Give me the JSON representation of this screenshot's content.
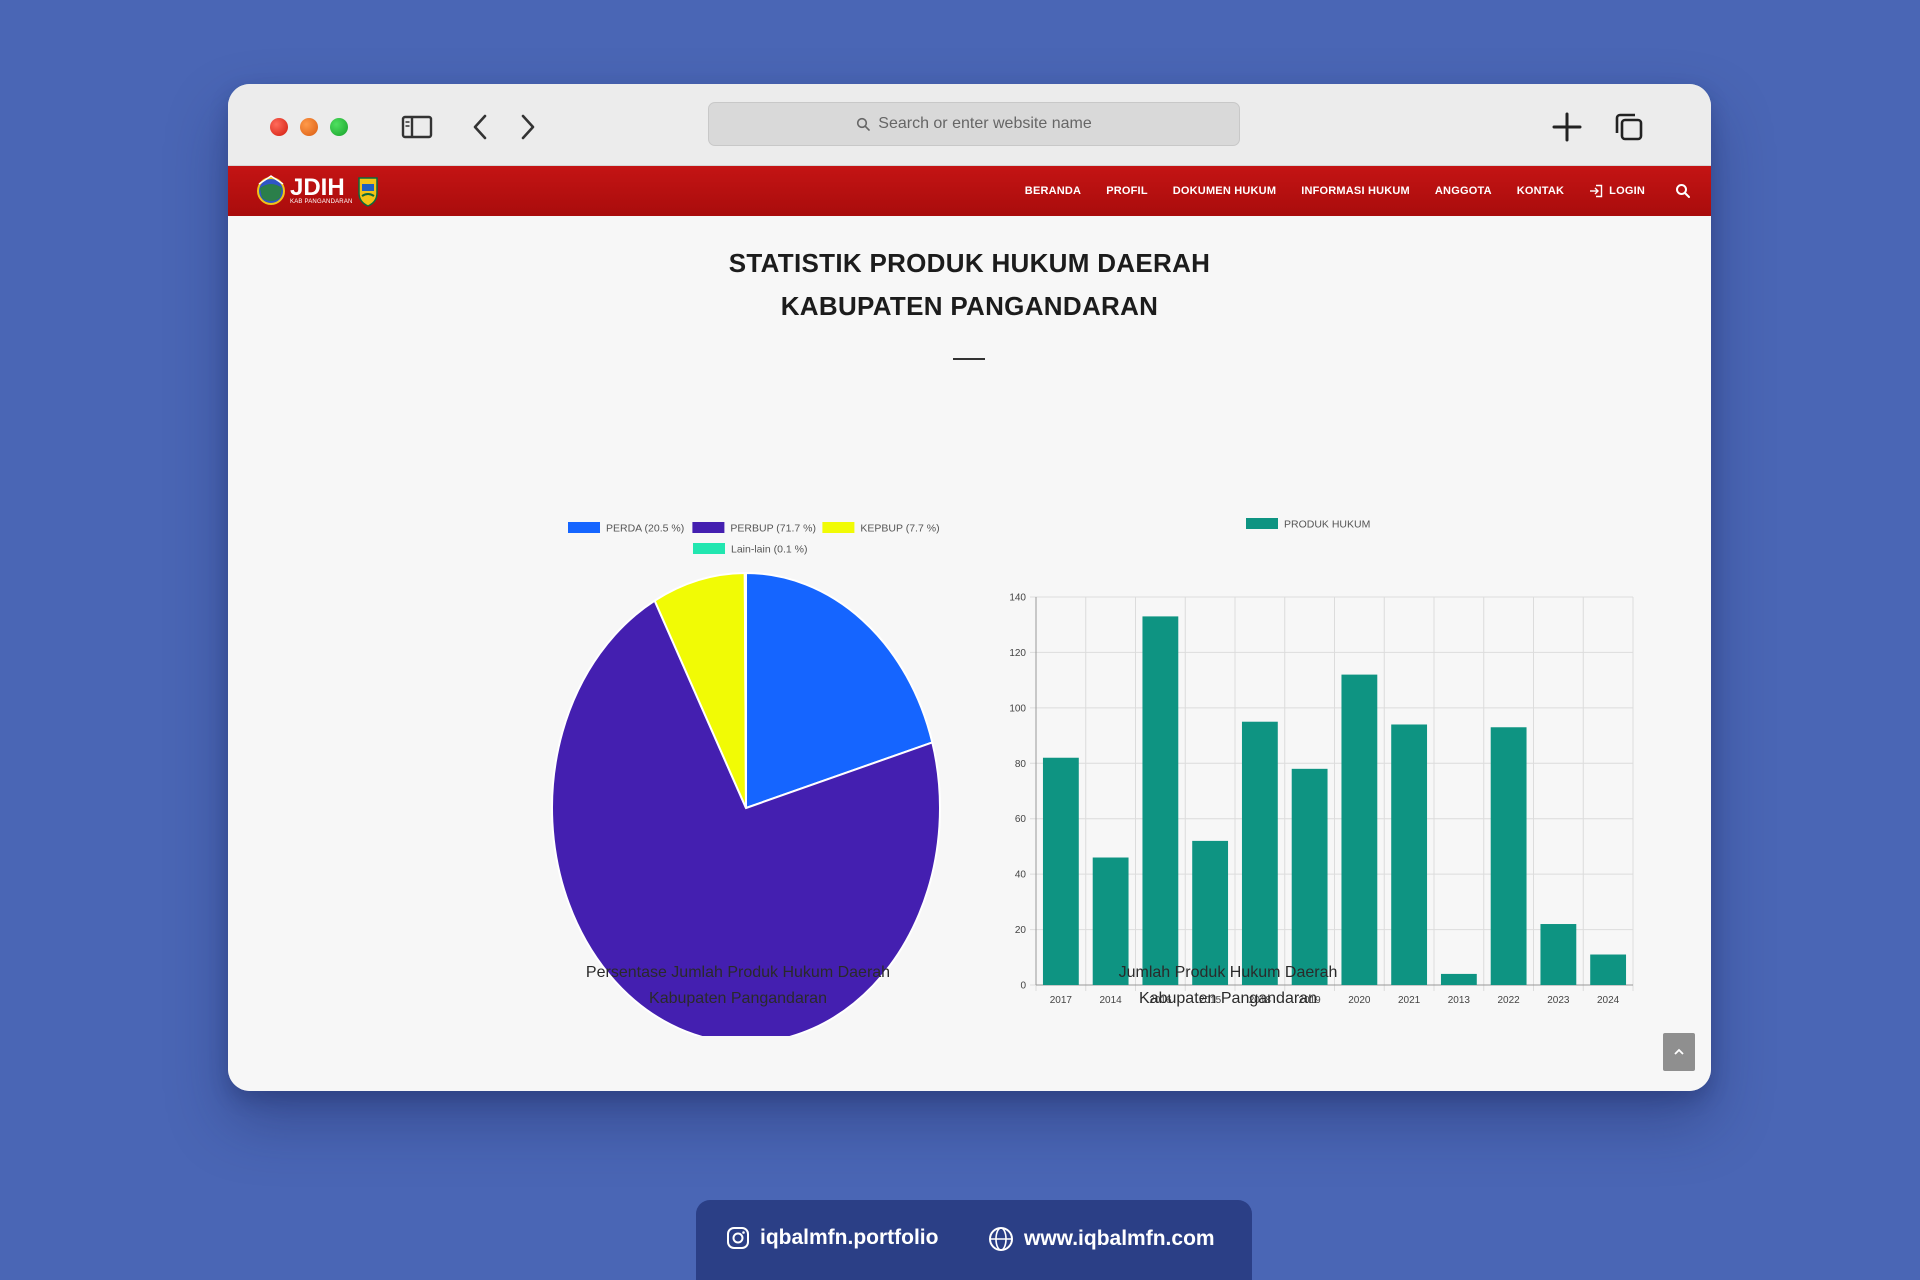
{
  "browser": {
    "address_placeholder": "Search or enter website name"
  },
  "site": {
    "logo_title": "JDIH",
    "logo_subtitle": "KAB PANGANDARAN",
    "menu": [
      {
        "label": "BERANDA"
      },
      {
        "label": "PROFIL"
      },
      {
        "label": "DOKUMEN HUKUM"
      },
      {
        "label": "INFORMASI HUKUM"
      },
      {
        "label": "ANGGOTA"
      },
      {
        "label": "KONTAK"
      },
      {
        "label": "LOGIN"
      }
    ]
  },
  "page": {
    "title_line1": "STATISTIK PRODUK HUKUM DAERAH",
    "title_line2": "KABUPATEN PANGANDARAN",
    "pie_caption_line1": "Persentase Jumlah Produk Hukum Daerah",
    "pie_caption_line2": "Kabupaten Pangandaran",
    "bar_caption_line1": "Jumlah Produk Hukum Daerah",
    "bar_caption_line2": "Kabupaten Pangandaran"
  },
  "chart_data": [
    {
      "type": "pie",
      "labels": [
        "PERDA (20.5 %)",
        "PERBUP (71.7 %)",
        "KEPBUP (7.7 %)",
        "Lain-lain (0.1 %)"
      ],
      "values": [
        20.5,
        71.7,
        7.7,
        0.1
      ],
      "colors": [
        "#1565ff",
        "#441fb0",
        "#f1fb05",
        "#22e6b0"
      ],
      "legend": "top"
    },
    {
      "type": "bar",
      "series": [
        {
          "name": "PRODUK HUKUM",
          "values": [
            82,
            46,
            133,
            52,
            95,
            78,
            112,
            94,
            4,
            93,
            22,
            11
          ]
        }
      ],
      "categories": [
        "2017",
        "2014",
        "2016",
        "2015",
        "2018",
        "2019",
        "2020",
        "2021",
        "2013",
        "2022",
        "2023",
        "2024"
      ],
      "ylim": [
        0,
        140
      ],
      "yticks": [
        "0",
        "20",
        "40",
        "60",
        "80",
        "100",
        "120",
        "140"
      ],
      "color": "#0e9482",
      "grid": true,
      "legend": "top"
    }
  ],
  "footer": {
    "instagram": "iqbalmfn.portfolio",
    "website": "www.iqbalmfn.com"
  }
}
